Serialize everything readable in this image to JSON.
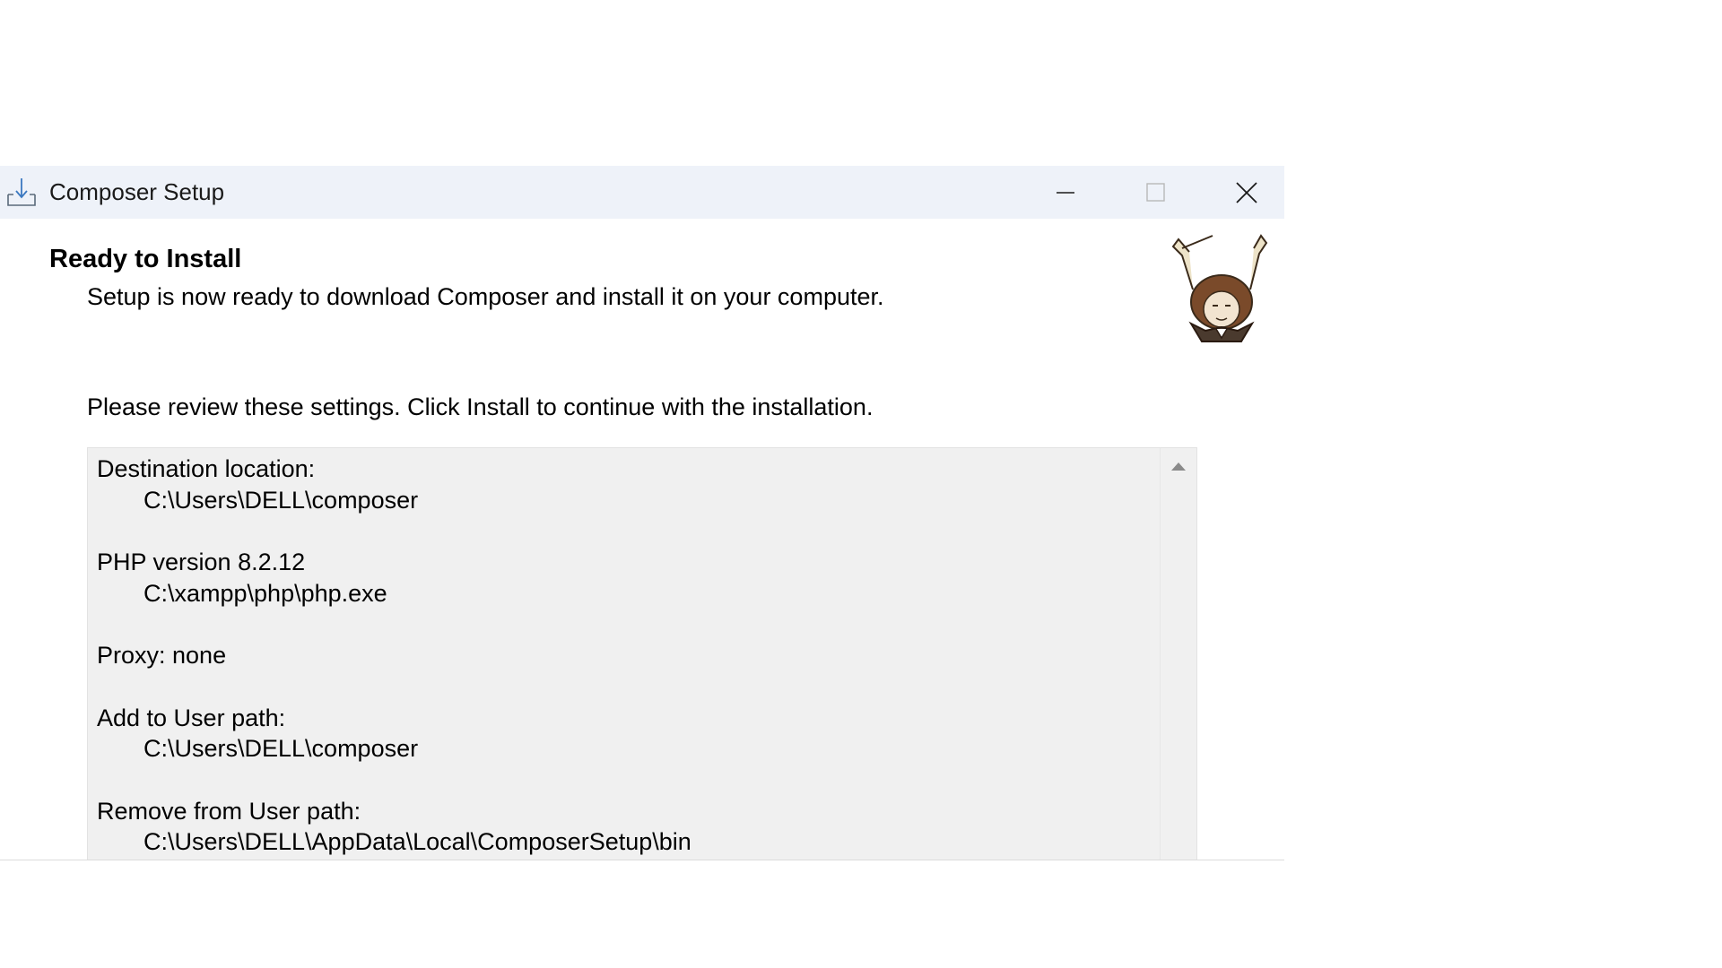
{
  "window": {
    "title": "Composer Setup",
    "app_icon": "install-download-icon",
    "controls": {
      "minimize_icon": "minimize-icon",
      "maximize_icon": "maximize-icon",
      "close_icon": "close-icon"
    }
  },
  "page": {
    "heading": "Ready to Install",
    "subheading": "Setup is now ready to download Composer and install it on your computer.",
    "mascot_icon": "composer-conductor-mascot-icon",
    "instructions": "Please review these settings. Click Install to continue with the installation."
  },
  "settings_memo": {
    "lines": [
      {
        "text": "Destination location:",
        "indent": false
      },
      {
        "text": "C:\\Users\\DELL\\composer",
        "indent": true
      },
      {
        "text": "",
        "indent": false
      },
      {
        "text": "PHP version 8.2.12",
        "indent": false
      },
      {
        "text": "C:\\xampp\\php\\php.exe",
        "indent": true
      },
      {
        "text": "",
        "indent": false
      },
      {
        "text": "Proxy: none",
        "indent": false
      },
      {
        "text": "",
        "indent": false
      },
      {
        "text": "Add to User path:",
        "indent": false
      },
      {
        "text": "C:\\Users\\DELL\\composer",
        "indent": true
      },
      {
        "text": "",
        "indent": false
      },
      {
        "text": "Remove from User path:",
        "indent": false
      },
      {
        "text": "C:\\Users\\DELL\\AppData\\Local\\ComposerSetup\\bin",
        "indent": true
      }
    ],
    "scroll_up_icon": "scroll-up-arrow-icon"
  }
}
